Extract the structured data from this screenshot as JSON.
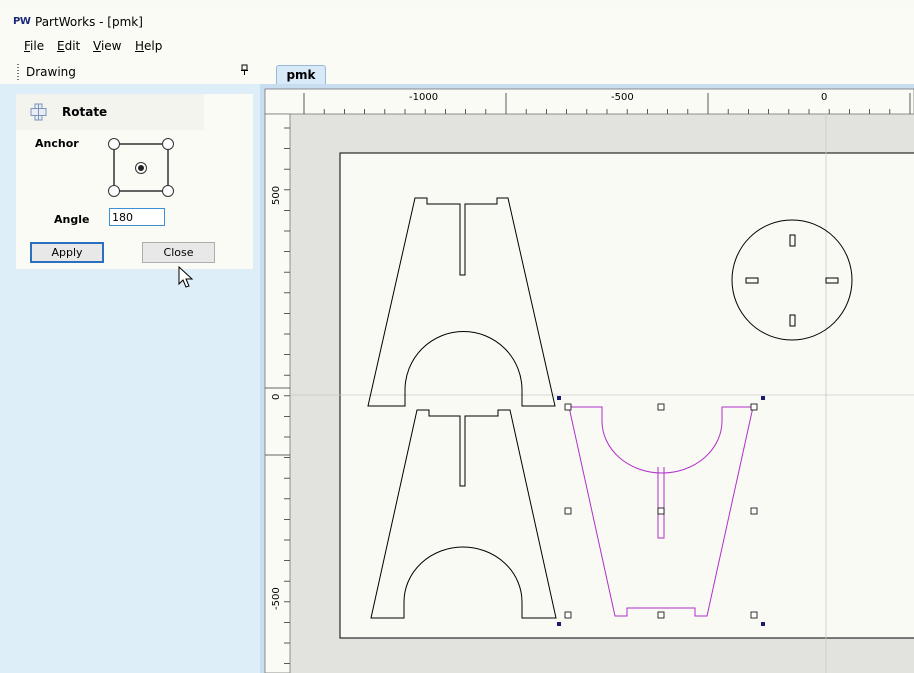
{
  "window": {
    "app_icon": "PW",
    "title": "PartWorks - [pmk]"
  },
  "menu": [
    {
      "label": "File",
      "key": "F",
      "rest": "ile"
    },
    {
      "label": "Edit",
      "key": "E",
      "rest": "dit"
    },
    {
      "label": "View",
      "key": "V",
      "rest": "iew"
    },
    {
      "label": "Help",
      "key": "H",
      "rest": "elp"
    }
  ],
  "panel": {
    "title": "Drawing",
    "pin_icon": "pin-icon"
  },
  "rotate": {
    "title": "Rotate",
    "icon": "rotate-icon",
    "anchor_label": "Anchor",
    "anchor_selected": "center",
    "angle_label": "Angle",
    "angle_value": "180",
    "apply_label": "Apply",
    "close_label": "Close"
  },
  "tabs": [
    {
      "label": "pmk",
      "active": true
    }
  ],
  "ruler": {
    "horizontal_labels": [
      "-1000",
      "-500",
      "0"
    ],
    "vertical_labels": [
      "500",
      "0",
      "-500"
    ]
  },
  "colors": {
    "sidebar_bg": "#ddeef8",
    "canvas_bg": "#fafaf5",
    "selection": "#b030c8",
    "handle_dark": "#1a1a6e"
  }
}
